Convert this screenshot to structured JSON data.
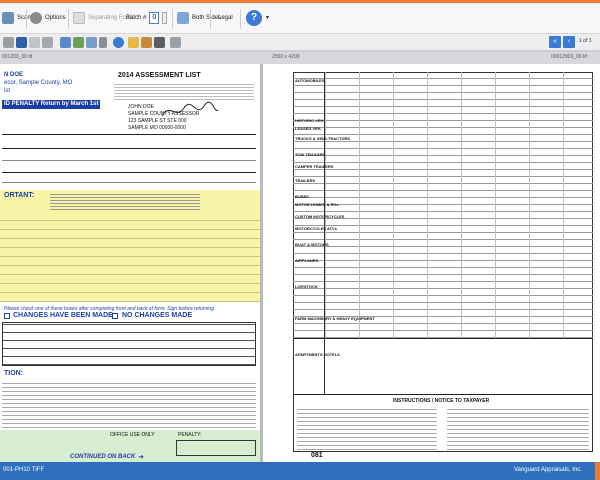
{
  "toolbar": {
    "scan": "Scan",
    "options": "Options",
    "separating_form": "Separating Form",
    "batch_label": "Batch #",
    "batch_value": "0",
    "both_sides": "Both Sides",
    "paper_size": "Legal",
    "help": "?"
  },
  "tabs": {
    "left": "001203_00 tif",
    "middle": "2550 x 4200",
    "right": "00012903_00.tif"
  },
  "pager": {
    "text": "1 of 1"
  },
  "left_doc": {
    "owner_line1": "N DOE",
    "owner_line2": "ecor, Sample County, MO",
    "owner_line3": "ist",
    "header_title": "2014 ASSESSMENT LIST",
    "penalty_banner": "ID PENALTY Return by March 1st",
    "addr1": "JOHN DOE",
    "addr2": "SAMPLE COUNTY ASSESSOR",
    "addr3": "123 SAMPLE ST STE 000",
    "addr4": "SAMPLE MO 00000-0000",
    "important": "ORTANT:",
    "changes_made": "CHANGES HAVE BEEN MADE",
    "no_changes": "NO CHANGES MADE",
    "check_one": "Please check one of these boxes after completing front and back of form. Sign before returning.",
    "notice_heading": "TION:",
    "penalty": "PENALTY:",
    "office_use": "OFFICE USE ONLY",
    "continued": "CONTINUED ON BACK"
  },
  "right_doc": {
    "row_labels": [
      "AUTOMOBILES",
      "HISTORIC VEH.",
      "LEASED VEH.",
      "TRUCKS & SEMI-TRACTORS",
      "TOW TRAILERS",
      "CAMPER TRAILERS",
      "TRAILERS",
      "BUSES",
      "MOTOR HOMES & RVs",
      "CUSTOM MOTORCYCLES",
      "MOTORCYCLES ATVs",
      "BOAT & MOTORS",
      "AIRPLANES",
      "LIVESTOCK",
      "FARM MACHINERY & HEAVY EQUIPMENT",
      "APARTMENTS HOTELS"
    ],
    "instructions_title": "INSTRUCTIONS / NOTICE TO TAXPAYER",
    "form_no": "081"
  },
  "status": {
    "left": "001-PH10 TIFF",
    "right": "Vanguard Appraisals, Inc."
  },
  "colors": {
    "accent": "#e87c2c",
    "status_bar": "#2f6fbf",
    "form_blue": "#1b3fa6",
    "highlight_yellow": "#f7f4a6"
  }
}
